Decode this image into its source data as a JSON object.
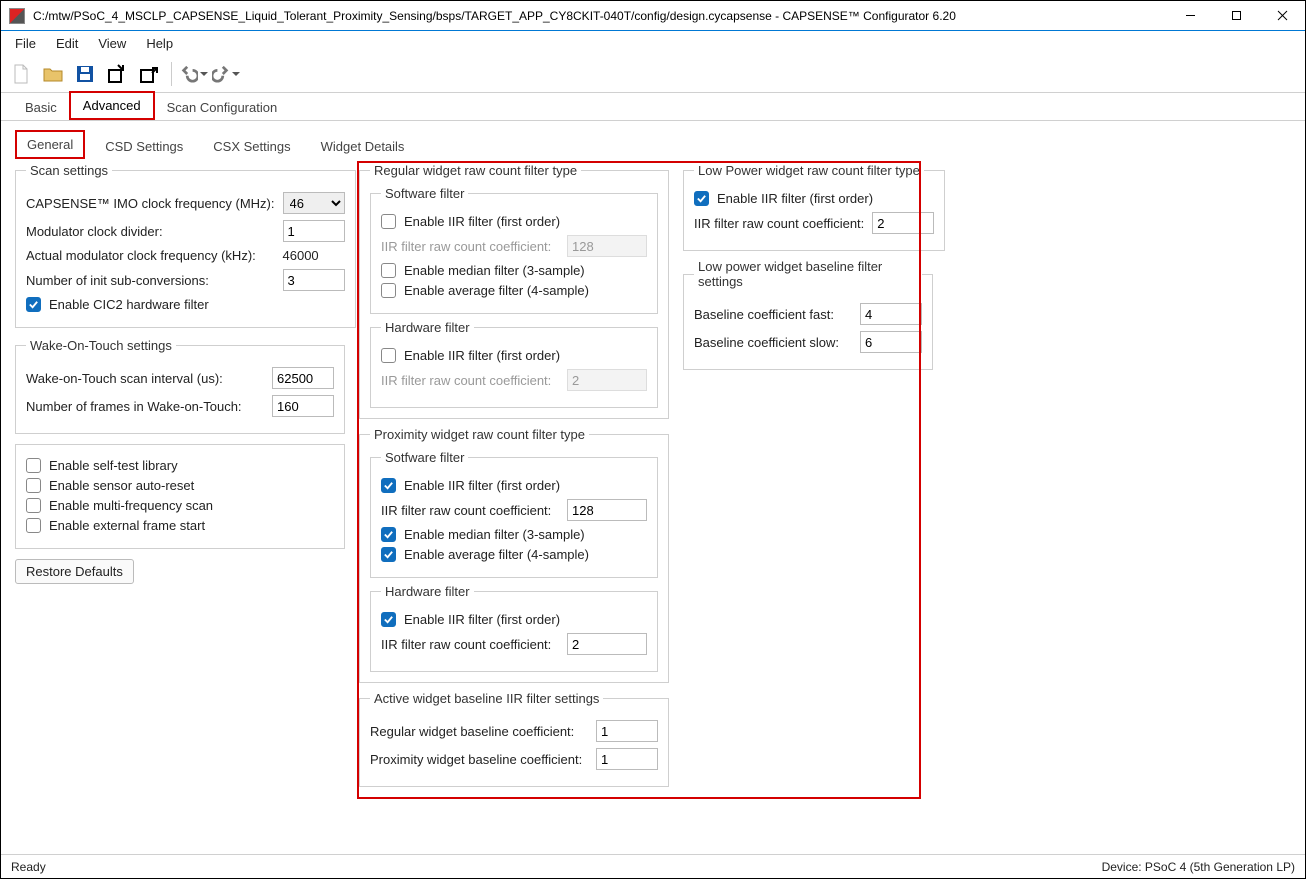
{
  "window": {
    "title": "C:/mtw/PSoC_4_MSCLP_CAPSENSE_Liquid_Tolerant_Proximity_Sensing/bsps/TARGET_APP_CY8CKIT-040T/config/design.cycapsense - CAPSENSE™ Configurator 6.20"
  },
  "menu": {
    "items": [
      "File",
      "Edit",
      "View",
      "Help"
    ]
  },
  "tabs1": [
    "Basic",
    "Advanced",
    "Scan Configuration"
  ],
  "tabs2": [
    "General",
    "CSD Settings",
    "CSX Settings",
    "Widget Details"
  ],
  "scan_settings": {
    "legend": "Scan settings",
    "imo_label": "CAPSENSE™ IMO clock frequency (MHz):",
    "imo_value": "46",
    "mod_div_label": "Modulator clock divider:",
    "mod_div_value": "1",
    "actual_freq_label": "Actual modulator clock frequency (kHz):",
    "actual_freq_value": "46000",
    "init_subconv_label": "Number of init sub-conversions:",
    "init_subconv_value": "3",
    "cic2_label": "Enable CIC2 hardware filter"
  },
  "wot": {
    "legend": "Wake-On-Touch settings",
    "interval_label": "Wake-on-Touch scan interval (us):",
    "interval_value": "62500",
    "frames_label": "Number of frames in Wake-on-Touch:",
    "frames_value": "160"
  },
  "misc": {
    "self_test": "Enable self-test library",
    "auto_reset": "Enable sensor auto-reset",
    "multi_freq": "Enable multi-frequency scan",
    "ext_frame": "Enable external frame start"
  },
  "restore_defaults": "Restore Defaults",
  "regular": {
    "legend": "Regular widget raw count filter type",
    "sw_legend": "Software filter",
    "iir_label": "Enable IIR filter (first order)",
    "iir_coef_label": "IIR filter raw count coefficient:",
    "iir_coef_value": "128",
    "median_label": "Enable median filter (3-sample)",
    "avg_label": "Enable average filter (4-sample)",
    "hw_legend": "Hardware filter",
    "hw_iir_label": "Enable IIR filter (first order)",
    "hw_iir_coef_label": "IIR filter raw count coefficient:",
    "hw_iir_coef_value": "2"
  },
  "proximity": {
    "legend": "Proximity widget raw count filter type",
    "sw_legend": "Sotfware filter",
    "iir_label": "Enable IIR filter (first order)",
    "iir_coef_label": "IIR filter raw count coefficient:",
    "iir_coef_value": "128",
    "median_label": "Enable median filter (3-sample)",
    "avg_label": "Enable average filter (4-sample)",
    "hw_legend": "Hardware filter",
    "hw_iir_label": "Enable IIR filter (first order)",
    "hw_iir_coef_label": "IIR filter raw count coefficient:",
    "hw_iir_coef_value": "2"
  },
  "active_baseline": {
    "legend": "Active widget baseline IIR filter settings",
    "reg_label": "Regular widget baseline coefficient:",
    "reg_value": "1",
    "prox_label": "Proximity widget baseline coefficient:",
    "prox_value": "1"
  },
  "lowpower": {
    "legend": "Low Power widget raw count filter type",
    "iir_label": "Enable IIR filter (first order)",
    "iir_coef_label": "IIR filter raw count coefficient:",
    "iir_coef_value": "2"
  },
  "lowpower_baseline": {
    "legend": "Low power widget baseline filter settings",
    "fast_label": "Baseline coefficient fast:",
    "fast_value": "4",
    "slow_label": "Baseline coefficient slow:",
    "slow_value": "6"
  },
  "status": {
    "left": "Ready",
    "right": "Device: PSoC 4 (5th Generation LP)"
  }
}
